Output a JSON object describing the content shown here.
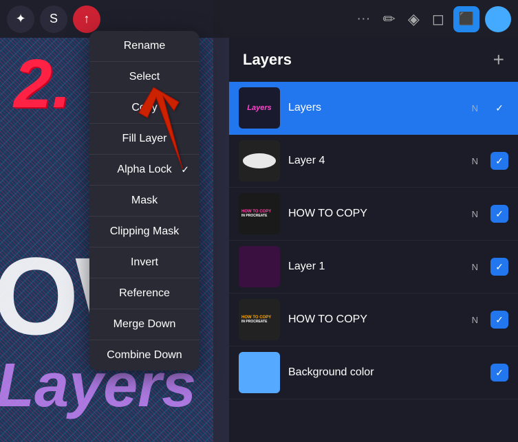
{
  "toolbar": {
    "dots_label": "···",
    "tool1": "✏",
    "tool2": "◆",
    "tool3": "◻",
    "layers_icon": "⬛",
    "add_label": "+"
  },
  "context_menu": {
    "items": [
      {
        "id": "rename",
        "label": "Rename",
        "has_check": false
      },
      {
        "id": "select",
        "label": "Select",
        "has_check": false
      },
      {
        "id": "copy",
        "label": "Copy",
        "has_check": false
      },
      {
        "id": "fill-layer",
        "label": "Fill Layer",
        "has_check": false
      },
      {
        "id": "alpha-lock",
        "label": "Alpha Lock",
        "has_check": true
      },
      {
        "id": "mask",
        "label": "Mask",
        "has_check": false
      },
      {
        "id": "clipping-mask",
        "label": "Clipping Mask",
        "has_check": false
      },
      {
        "id": "invert",
        "label": "Invert",
        "has_check": false
      },
      {
        "id": "reference",
        "label": "Reference",
        "has_check": false
      },
      {
        "id": "merge-down",
        "label": "Merge Down",
        "has_check": false
      },
      {
        "id": "combine-down",
        "label": "Combine Down",
        "has_check": false
      }
    ]
  },
  "layers_panel": {
    "title": "Layers",
    "add_button": "+",
    "layers": [
      {
        "id": "layers-layer",
        "name": "Layers",
        "mode": "N",
        "active": true,
        "visible": true
      },
      {
        "id": "layer-4",
        "name": "Layer 4",
        "mode": "N",
        "active": false,
        "visible": true
      },
      {
        "id": "how-to-copy",
        "name": "HOW TO COPY",
        "mode": "N",
        "active": false,
        "visible": true
      },
      {
        "id": "layer-1",
        "name": "Layer 1",
        "mode": "N",
        "active": false,
        "visible": true
      },
      {
        "id": "how-to-copy-2",
        "name": "HOW TO COPY",
        "mode": "N",
        "active": false,
        "visible": true
      },
      {
        "id": "background-color",
        "name": "Background color",
        "mode": "",
        "active": false,
        "visible": true
      }
    ]
  },
  "canvas": {
    "number": "2.",
    "big_text": "OW",
    "layers_text": "Layers"
  }
}
